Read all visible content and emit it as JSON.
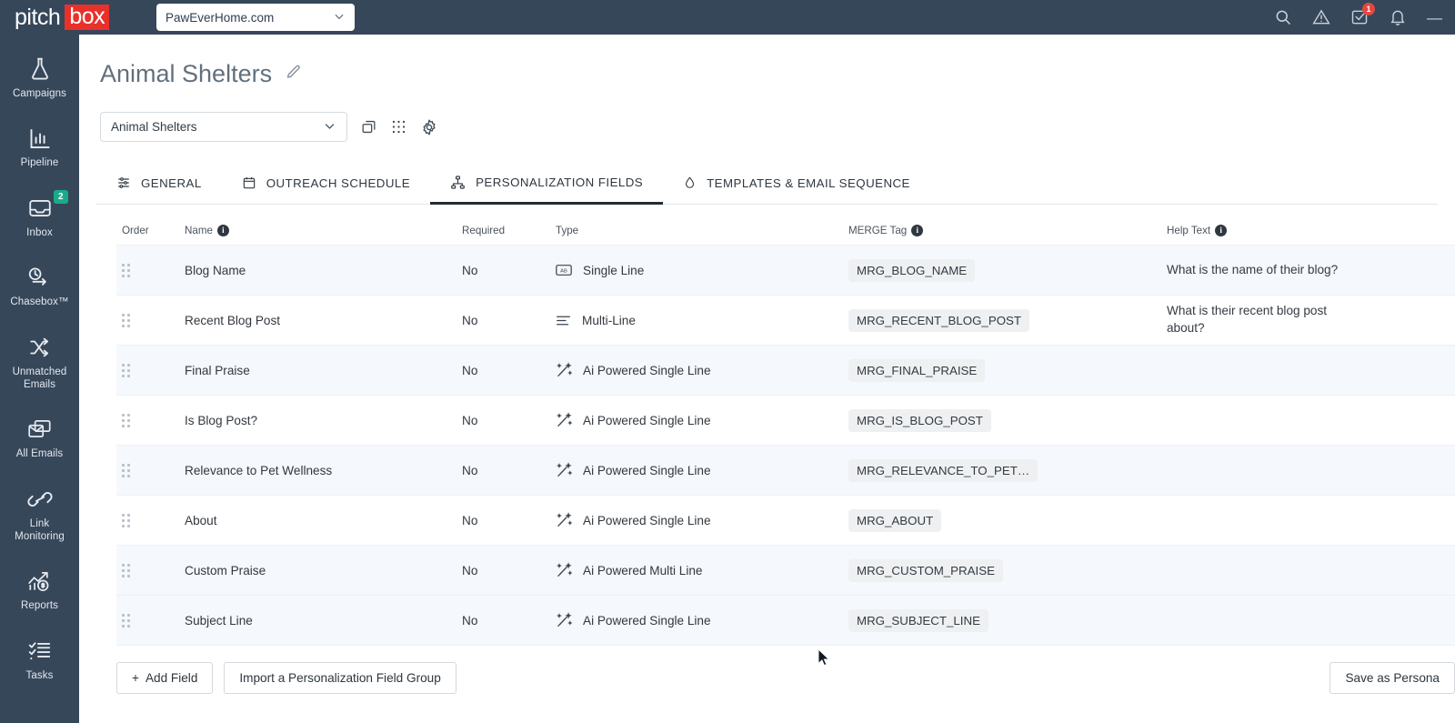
{
  "topbar": {
    "logo_pitch": "pitch",
    "logo_box": "box",
    "site_value": "PawEverHome.com",
    "icons": [
      {
        "name": "search-icon",
        "label": "Search"
      },
      {
        "name": "alert-icon",
        "label": "Alerts"
      },
      {
        "name": "tasks-inbox-icon",
        "label": "Notifications",
        "badge": "1"
      },
      {
        "name": "bell-icon",
        "label": "Notification bell"
      }
    ]
  },
  "sidebar": {
    "items": [
      {
        "label": "Campaigns",
        "icon": "flask-icon",
        "badge": null
      },
      {
        "label": "Pipeline",
        "icon": "bar-chart-icon",
        "badge": null
      },
      {
        "label": "Inbox",
        "icon": "inbox-tray-icon",
        "badge": "2"
      },
      {
        "label": "Chasebox™",
        "icon": "clock-arrow-icon",
        "badge": null
      },
      {
        "label": "Unmatched Emails",
        "icon": "shuffle-icon",
        "badge": null
      },
      {
        "label": "All Emails",
        "icon": "envelopes-icon",
        "badge": null
      },
      {
        "label": "Link Monitoring",
        "icon": "link-chain-icon",
        "badge": null
      },
      {
        "label": "Reports",
        "icon": "trend-dollar-icon",
        "badge": null
      },
      {
        "label": "Tasks",
        "icon": "checklist-icon",
        "badge": null
      }
    ]
  },
  "page": {
    "title": "Animal Shelters",
    "campaign_select_value": "Animal Shelters"
  },
  "tabs": [
    {
      "label": "GENERAL",
      "icon": "sliders-icon",
      "active": false
    },
    {
      "label": "OUTREACH SCHEDULE",
      "icon": "calendar-icon",
      "active": false
    },
    {
      "label": "PERSONALIZATION FIELDS",
      "icon": "sitemap-icon",
      "active": true
    },
    {
      "label": "TEMPLATES & EMAIL SEQUENCE",
      "icon": "droplet-icon",
      "active": false
    }
  ],
  "table": {
    "headers": {
      "order": "Order",
      "name": "Name",
      "required": "Required",
      "type": "Type",
      "merge_tag": "MERGE Tag",
      "help_text": "Help Text"
    },
    "rows": [
      {
        "name": "Blog Name",
        "required": "No",
        "type": "Single Line",
        "type_icon": "ab-box-icon",
        "merge_tag": "MRG_BLOG_NAME",
        "help_text": "What is the name of their blog?"
      },
      {
        "name": "Recent Blog Post",
        "required": "No",
        "type": "Multi-Line",
        "type_icon": "lines-icon",
        "merge_tag": "MRG_RECENT_BLOG_POST",
        "help_text": "What is their recent blog post about?"
      },
      {
        "name": "Final Praise",
        "required": "No",
        "type": "Ai Powered Single Line",
        "type_icon": "magic-wand-icon",
        "merge_tag": "MRG_FINAL_PRAISE",
        "help_text": ""
      },
      {
        "name": "Is Blog Post?",
        "required": "No",
        "type": "Ai Powered Single Line",
        "type_icon": "magic-wand-icon",
        "merge_tag": "MRG_IS_BLOG_POST",
        "help_text": ""
      },
      {
        "name": "Relevance to Pet Wellness",
        "required": "No",
        "type": "Ai Powered Single Line",
        "type_icon": "magic-wand-icon",
        "merge_tag": "MRG_RELEVANCE_TO_PET…",
        "help_text": ""
      },
      {
        "name": "About",
        "required": "No",
        "type": "Ai Powered Single Line",
        "type_icon": "magic-wand-icon",
        "merge_tag": "MRG_ABOUT",
        "help_text": ""
      },
      {
        "name": "Custom Praise",
        "required": "No",
        "type": "Ai Powered Multi Line",
        "type_icon": "magic-wand-icon",
        "merge_tag": "MRG_CUSTOM_PRAISE",
        "help_text": ""
      },
      {
        "name": "Subject Line",
        "required": "No",
        "type": "Ai Powered Single Line",
        "type_icon": "magic-wand-icon",
        "merge_tag": "MRG_SUBJECT_LINE",
        "help_text": ""
      }
    ]
  },
  "footer": {
    "add_field": "Add Field",
    "add_field_plus": "+",
    "import_group": "Import a Personalization Field Group",
    "save_as_persona": "Save as Persona"
  },
  "colors": {
    "sidebar_bg": "#37475a",
    "logo_red": "#e8312a",
    "badge_green": "#1aab8b",
    "badge_red": "#e3473f",
    "row_alt": "#f5f8fc",
    "active_tab_underline": "#222b33"
  }
}
